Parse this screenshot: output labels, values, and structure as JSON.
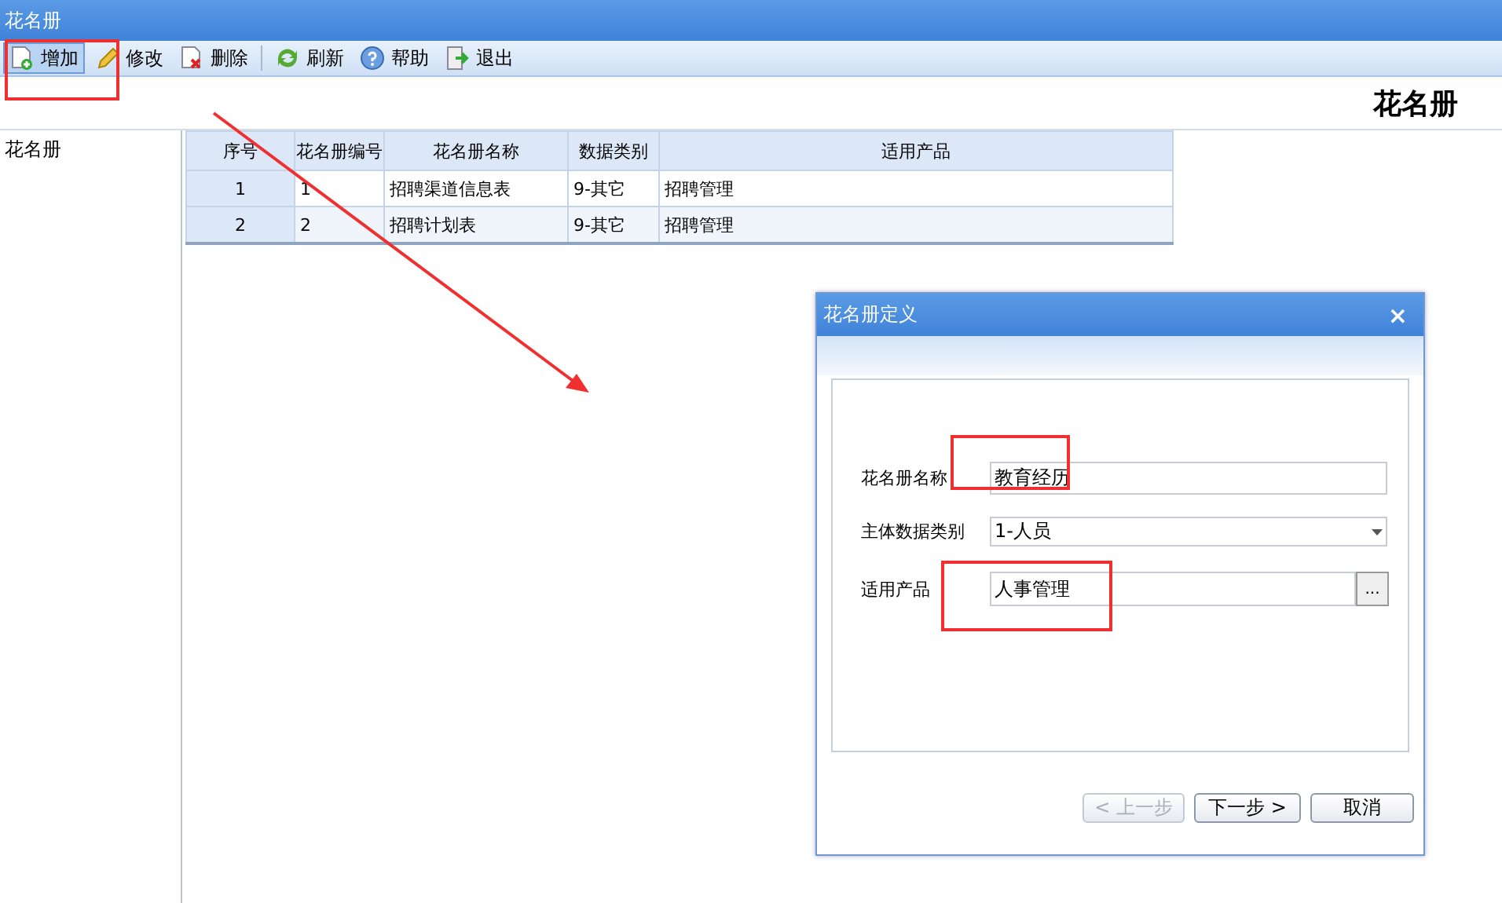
{
  "window": {
    "title": "花名册"
  },
  "toolbar": [
    {
      "label": "增加",
      "selected": true
    },
    {
      "label": "修改",
      "selected": false
    },
    {
      "label": "删除",
      "selected": false
    },
    {
      "label": "刷新",
      "selected": false
    },
    {
      "label": "帮助",
      "selected": false
    },
    {
      "label": "退出",
      "selected": false
    }
  ],
  "heading": "花名册",
  "sidebar": {
    "items": [
      {
        "label": "花名册",
        "selected": false
      }
    ]
  },
  "table": {
    "columns": [
      "序号",
      "花名册编号",
      "花名册名称",
      "数据类别",
      "适用产品"
    ],
    "rows": [
      [
        "1",
        "1",
        "招聘渠道信息表",
        "9-其它",
        "招聘管理"
      ],
      [
        "2",
        "2",
        "招聘计划表",
        "9-其它",
        "招聘管理"
      ]
    ]
  },
  "dialog": {
    "title": "花名册定义",
    "close": "×",
    "fields": [
      {
        "kind": "text",
        "label": "花名册名称",
        "value": "教育经历"
      },
      {
        "kind": "select",
        "label": "主体数据类别",
        "value": "1-人员"
      },
      {
        "kind": "picker",
        "label": "适用产品",
        "value": "人事管理",
        "button": "..."
      }
    ],
    "buttons": [
      {
        "label": "< 上一步",
        "disabled": true
      },
      {
        "label": "下一步 >",
        "disabled": false
      },
      {
        "label": "取消",
        "disabled": false
      }
    ]
  }
}
